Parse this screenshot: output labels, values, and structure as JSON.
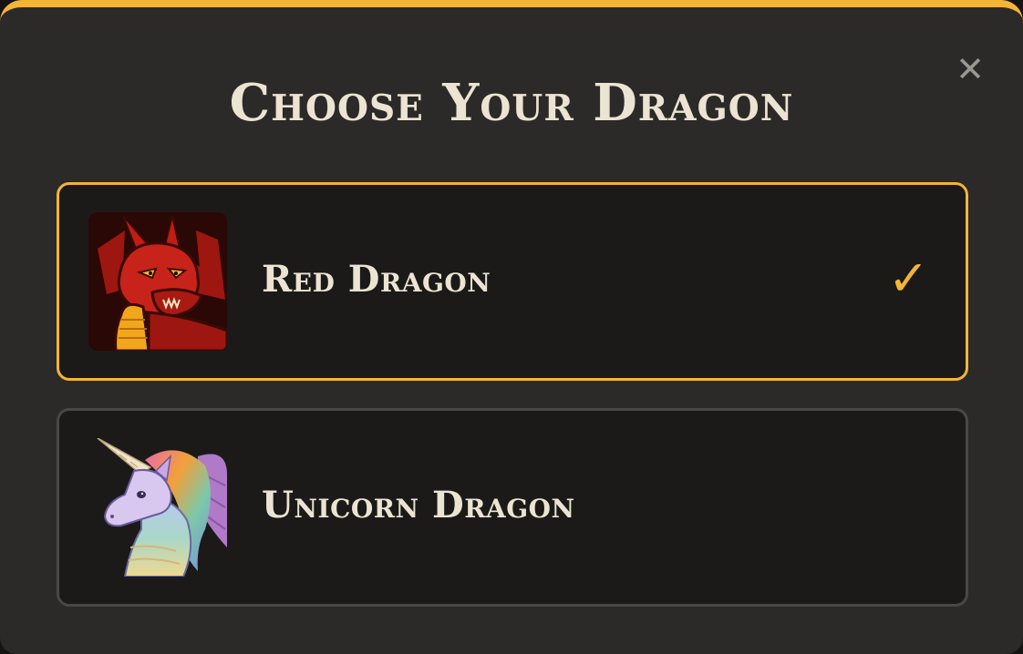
{
  "dialog": {
    "title": "Choose Your Dragon",
    "close_icon": "close-icon",
    "close_glyph": "✕",
    "accent_color": "#f2b535"
  },
  "options": [
    {
      "label": "Red Dragon",
      "portrait_icon": "red-dragon-portrait",
      "selected": true,
      "check_glyph": "✓"
    },
    {
      "label": "Unicorn Dragon",
      "portrait_icon": "unicorn-dragon-portrait",
      "selected": false
    }
  ]
}
